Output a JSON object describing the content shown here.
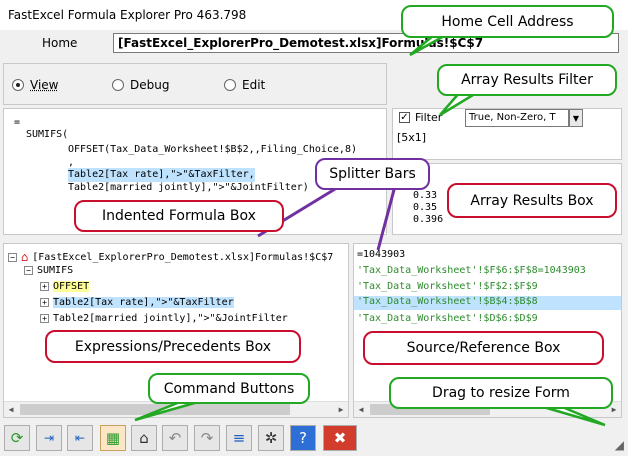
{
  "window": {
    "title": "FastExcel Formula Explorer Pro 463.798"
  },
  "home": {
    "label": "Home",
    "address": "[FastExcel_ExplorerPro_Demotest.xlsx]Formulas!$C$7"
  },
  "modes": [
    {
      "label": "View",
      "selected": true
    },
    {
      "label": "Debug",
      "selected": false
    },
    {
      "label": "Edit",
      "selected": false
    }
  ],
  "formula": {
    "lines": [
      "=",
      "SUMIFS(",
      "OFFSET(Tax_Data_Worksheet!$B$2,,Filing_Choice,8)",
      ",",
      "Table2[Tax rate],\">\"&TaxFilter,",
      "Table2[married jointly],\">\"&JointFilter)"
    ]
  },
  "filter": {
    "label": "Filter",
    "checked": true,
    "option": "True, Non-Zero, T",
    "dimensions": "[5x1]"
  },
  "array_results": [
    "0.33",
    "0.35",
    "0.396"
  ],
  "tree": {
    "root": "[FastExcel_ExplorerPro_Demotest.xlsx]Formulas!$C$7",
    "items": [
      "SUMIFS",
      "OFFSET",
      "Table2[Tax rate],\">\"&TaxFilter",
      "Table2[married jointly],\">\"&JointFilter"
    ]
  },
  "sources": [
    "=1043903",
    "'Tax_Data_Worksheet'!$F$6:$F$8=1043903",
    "'Tax_Data_Worksheet'!$F$2:$F$9",
    "'Tax_Data_Worksheet'!$B$4:$B$8",
    "'Tax_Data_Worksheet'!$D$6:$D$9"
  ],
  "callouts": {
    "home_cell": "Home Cell Address",
    "array_filter": "Array Results Filter",
    "splitter": "Splitter Bars",
    "array_box": "Array Results Box",
    "indented": "Indented Formula Box",
    "expressions": "Expressions/Precedents Box",
    "source": "Source/Reference Box",
    "commands": "Command Buttons",
    "resize": "Drag to resize Form"
  },
  "toolbar_icons": [
    "refresh-icon",
    "step-in-icon",
    "step-out-icon",
    "grid-icon",
    "home-icon",
    "undo-icon",
    "redo-icon",
    "list-icon",
    "settings-icon",
    "help-icon",
    "close-icon"
  ],
  "colors": {
    "highlight": "#bfe3ff",
    "green_callout": "#22a822",
    "red_callout": "#c8102e",
    "purple_callout": "#7030a0",
    "source_text": "#2e8b2e"
  }
}
